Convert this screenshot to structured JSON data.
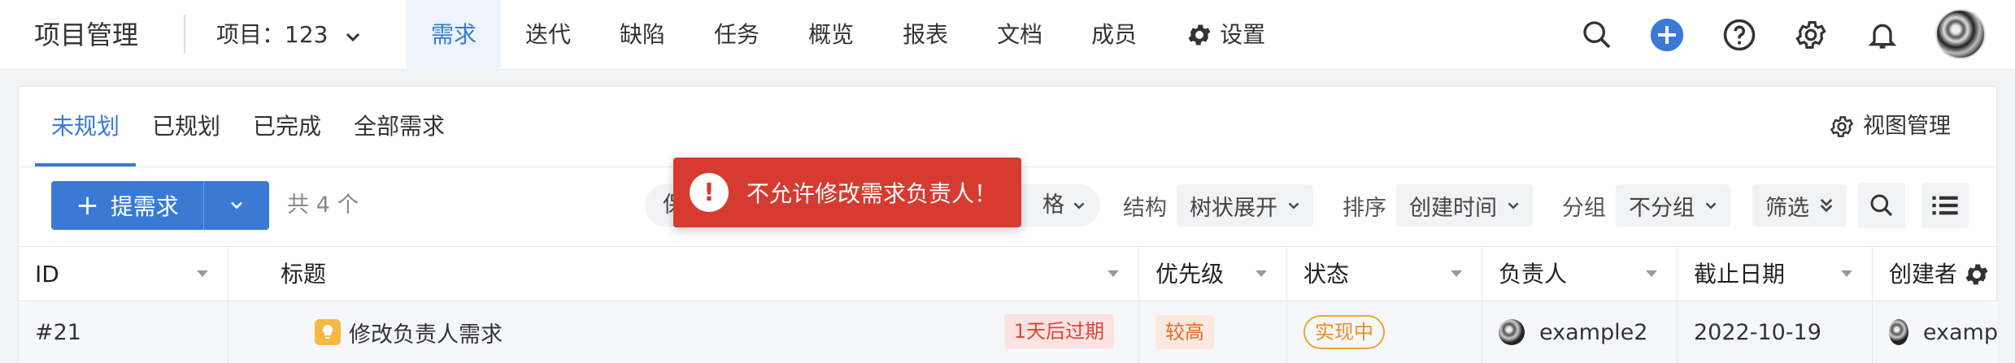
{
  "app": {
    "title": "项目管理"
  },
  "project": {
    "label": "项目：123"
  },
  "nav": [
    {
      "label": "需求"
    },
    {
      "label": "迭代"
    },
    {
      "label": "缺陷"
    },
    {
      "label": "任务"
    },
    {
      "label": "概览"
    },
    {
      "label": "报表"
    },
    {
      "label": "文档"
    },
    {
      "label": "成员"
    },
    {
      "label": "设置"
    }
  ],
  "tabs": [
    {
      "label": "未规划"
    },
    {
      "label": "已规划"
    },
    {
      "label": "已完成"
    },
    {
      "label": "全部需求"
    }
  ],
  "view_manage": "视图管理",
  "toolbar": {
    "create_label": "提需求",
    "count": "共 4 个",
    "hidden_left": "保",
    "hidden_right": "格",
    "structure_label": "结构",
    "structure_value": "树状展开",
    "sort_label": "排序",
    "sort_value": "创建时间",
    "group_label": "分组",
    "group_value": "不分组",
    "filter_label": "筛选"
  },
  "table": {
    "columns": [
      "ID",
      "标题",
      "优先级",
      "状态",
      "负责人",
      "截止日期",
      "创建者"
    ],
    "rows": [
      {
        "id": "#21",
        "title": "修改负责人需求",
        "overdue": "1天后过期",
        "priority": "较高",
        "status": "实现中",
        "owner": "example2",
        "due": "2022-10-19",
        "creator": "examp"
      }
    ]
  },
  "toast": {
    "message": "不允许修改需求负责人！",
    "icon": "!"
  },
  "colors": {
    "accent": "#3a7ad5",
    "error": "#d73a30",
    "warning": "#f0a33b"
  }
}
